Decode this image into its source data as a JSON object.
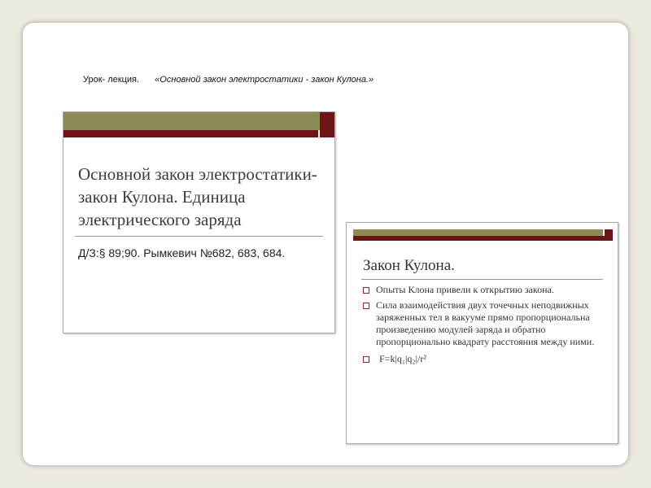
{
  "header": {
    "prefix": "Урок- лекция.",
    "title": "«Основной закон электростатики - закон Кулона.»"
  },
  "slide1": {
    "title_lines": [
      "Основной закон электростатики-",
      "закон Кулона. Единица",
      "электрического заряда"
    ],
    "homework": "Д/З:§ 89;90. Рымкевич №682, 683, 684."
  },
  "slide2": {
    "title": "Закон Кулона.",
    "bullets": [
      "Опыты Клона привели к открытию закона.",
      "Сила  взаимодействия двух точечных неподвижных заряженных тел в вакууме прямо пропорциональна произведению модулей заряда и обратно пропорционально квадрату расстояния между ними.",
      "F=k|q₁|q₂|/r²"
    ]
  },
  "colors": {
    "olive": "#8d8a55",
    "maroon": "#6d1414",
    "background": "#ece9e0"
  }
}
